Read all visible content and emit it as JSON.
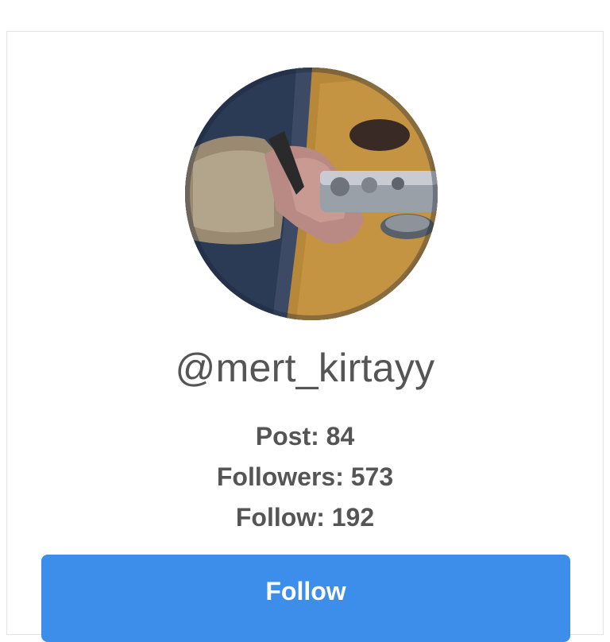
{
  "profile": {
    "username": "@mert_kirtayy",
    "avatar_icon": "profile-photo-camera-hands",
    "stats": {
      "post": "Post: 84",
      "followers": "Followers: 573",
      "follow": "Follow: 192"
    }
  },
  "actions": {
    "follow_label": "Follow"
  },
  "colors": {
    "button_bg": "#3d8eea",
    "text": "#555555",
    "card_border": "#e3e3e3"
  }
}
